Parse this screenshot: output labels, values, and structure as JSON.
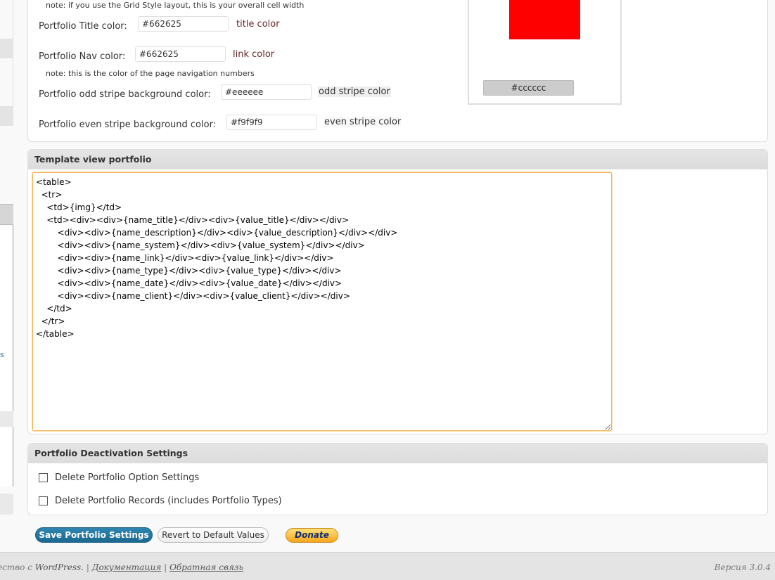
{
  "colors": {
    "title_color": "#662625",
    "nav_color": "#662625",
    "odd_stripe": "#eeeeee",
    "even_stripe": "#f9f9f9",
    "preview_swatch": "#ff0000",
    "accent_button": "#21759b",
    "textarea_focus": "#f0b35a"
  },
  "menu": {
    "link_fragment": "s"
  },
  "settings": {
    "grid_note": "note: if you use the Grid Style layout, this is your overall cell width",
    "title_color_label": "Portfolio Title color:",
    "title_color_value": "#662625",
    "title_color_preview": "title color",
    "nav_color_label": "Portfolio Nav color:",
    "nav_color_value": "#662625",
    "nav_color_preview": "link color",
    "nav_note": "note: this is the color of the page navigation numbers",
    "odd_label": "Portfolio odd stripe background color:",
    "odd_value": "#eeeeee",
    "odd_preview": "odd stripe color",
    "even_label": "Portfolio even stripe background color:",
    "even_value": "#f9f9f9",
    "even_preview": "even stripe color",
    "picker_hex": "#cccccc"
  },
  "template": {
    "heading": "Template view portfolio",
    "code": "<table>\n  <tr>\n    <td>{img}</td>\n    <td><div><div>{name_title}</div><div>{value_title}</div></div>\n        <div><div>{name_description}</div><div>{value_description}</div></div>\n        <div><div>{name_system}</div><div>{value_system}</div></div>\n        <div><div>{name_link}</div><div>{value_link}</div></div>\n        <div><div>{name_type}</div><div>{value_type}</div></div>\n        <div><div>{name_date}</div><div>{value_date}</div></div>\n        <div><div>{name_client}</div><div>{value_client}</div></div>\n    </td>\n  </tr>\n</table>"
  },
  "deactivation": {
    "heading": "Portfolio Deactivation Settings",
    "delete_options_label": "Delete Portfolio Option Settings",
    "delete_records_label": "Delete Portfolio Records (includes Portfolio Types)"
  },
  "buttons": {
    "save": "Save Portfolio Settings",
    "revert": "Revert to Default Values",
    "donate": "Donate"
  },
  "footer": {
    "prefix": "ество с",
    "wordpress": "WordPress.",
    "docs": "Документация",
    "feedback": "Обратная связь",
    "sep": "|",
    "version": "Версия 3.0.4"
  }
}
